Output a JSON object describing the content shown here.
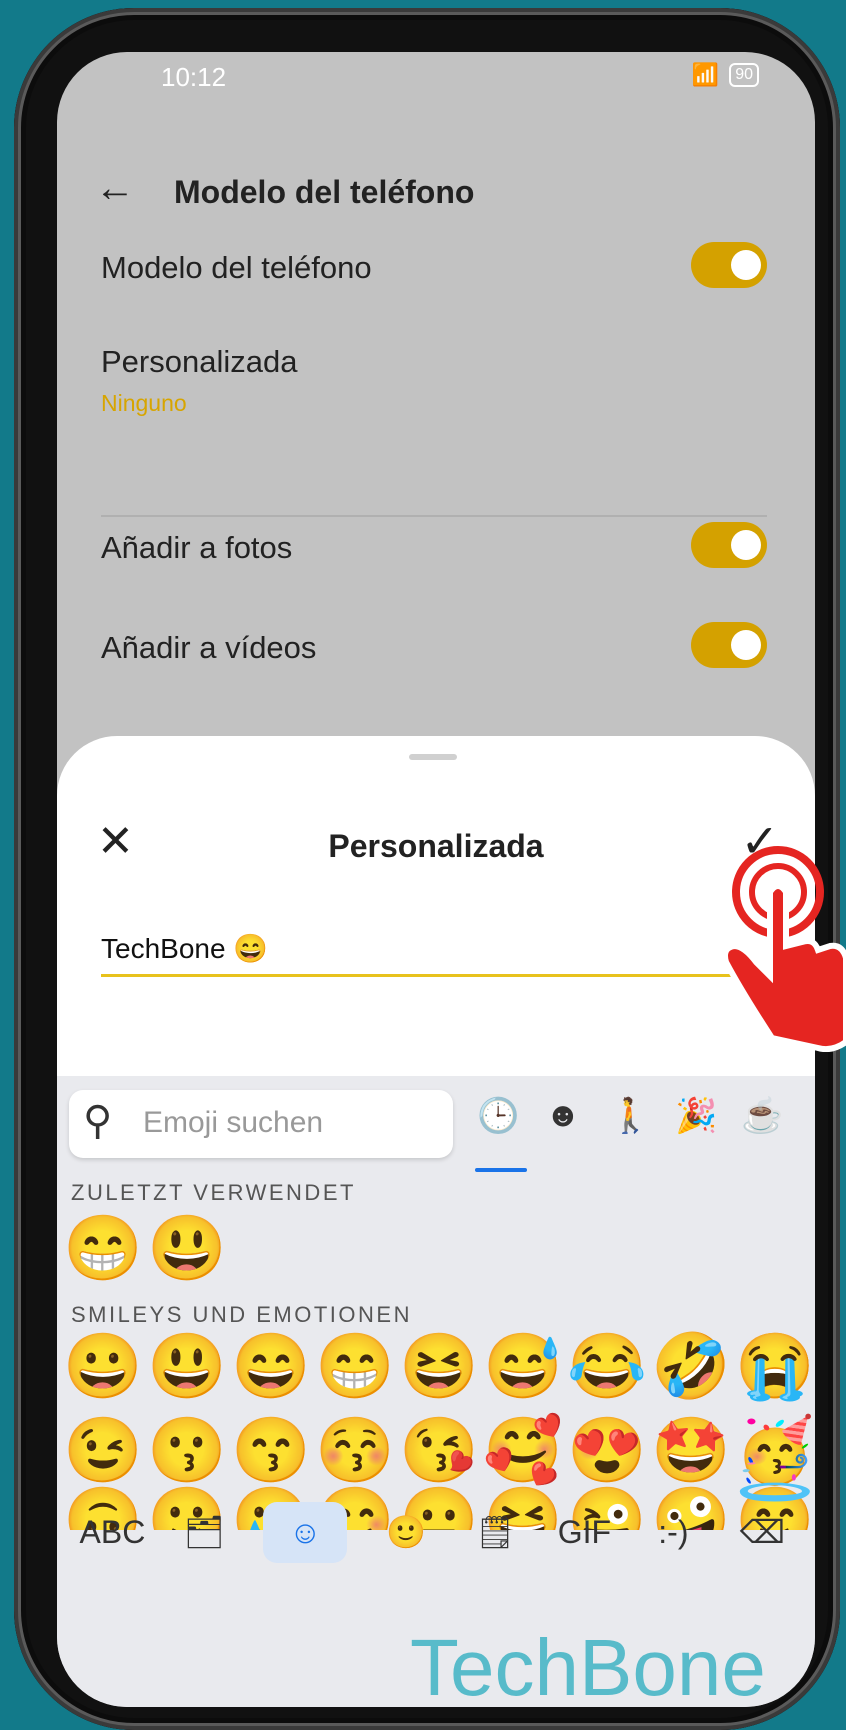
{
  "status": {
    "time": "10:12",
    "battery": "90"
  },
  "appbar": {
    "title": "Modelo del teléfono"
  },
  "settings": [
    {
      "label": "Modelo del teléfono",
      "toggle": true
    },
    {
      "label": "Personalizada",
      "sub": "Ninguno"
    },
    {
      "label": "Añadir a fotos",
      "toggle": true
    },
    {
      "label": "Añadir a vídeos",
      "toggle": true
    }
  ],
  "sheet": {
    "title": "Personalizada",
    "input_value": "TechBone 😄"
  },
  "keyboard": {
    "search_placeholder": "Emoji suchen",
    "recent_title": "ZULETZT VERWENDET",
    "recent": [
      "😁",
      "😃"
    ],
    "smileys_title": "SMILEYS UND EMOTIONEN",
    "row1": [
      "😀",
      "😃",
      "😄",
      "😁",
      "😆",
      "😅",
      "😂",
      "🤣",
      "😭"
    ],
    "row2": [
      "😉",
      "😗",
      "😙",
      "😚",
      "😘",
      "🥰",
      "😍",
      "🤩",
      "🥳"
    ],
    "row3": [
      "🙃",
      "🙂",
      "🥲",
      "😊",
      "😐",
      "😆",
      "😜",
      "🤪",
      "😇"
    ],
    "bottom": {
      "abc": "ABC",
      "gif": "GIF",
      "emoticon": ":-)"
    }
  },
  "watermark": "TechBone"
}
